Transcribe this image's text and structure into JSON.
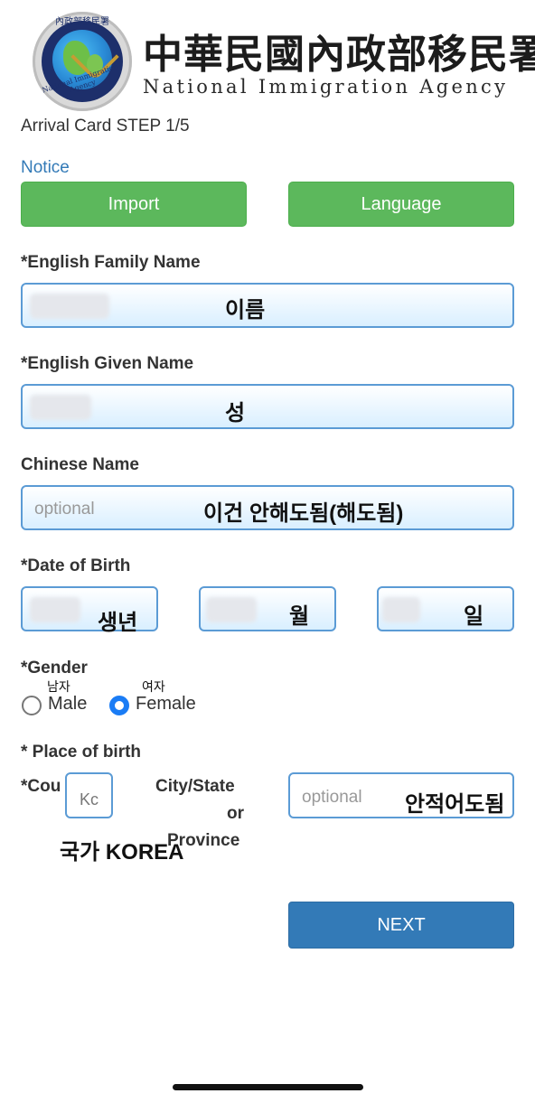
{
  "header": {
    "logo_text_top": "內政部移民署",
    "logo_text_bottom": "National Immigration Agency",
    "agency_name_zh": "中華民國內政部移民署",
    "agency_name_en": "National Immigration Agency"
  },
  "page": {
    "step": "Arrival Card STEP 1/5",
    "notice_link": "Notice"
  },
  "buttons": {
    "import": "Import",
    "language": "Language",
    "next": "NEXT"
  },
  "form": {
    "family_name_label": "*English Family Name",
    "family_name_annotation": "이름",
    "given_name_label": "*English Given Name",
    "given_name_annotation": "성",
    "chinese_name_label": "Chinese Name",
    "chinese_name_placeholder": "optional",
    "chinese_name_annotation": "이건 안해도됨(해도됨)",
    "dob_label": "*Date of Birth",
    "dob_year_annotation": "생년",
    "dob_month_annotation": "월",
    "dob_day_annotation": "일",
    "gender_label": "*Gender",
    "gender_male": "Male",
    "gender_female": "Female",
    "gender_male_annotation": "남자",
    "gender_female_annotation": "여자",
    "gender_selected": "Female",
    "place_of_birth_label": "* Place of birth",
    "country_label": "*Cou",
    "country_value": "Kc",
    "country_annotation": "국가 KOREA",
    "city_label_1": "City/State",
    "city_label_2": "or",
    "city_label_3": "Province",
    "city_placeholder": "optional",
    "city_annotation": "안적어도됨"
  },
  "colors": {
    "green_button": "#5cb85c",
    "blue_button": "#337ab7",
    "link": "#337ab7",
    "field_border": "#5b9bd5",
    "radio_selected": "#1a7cf5"
  }
}
